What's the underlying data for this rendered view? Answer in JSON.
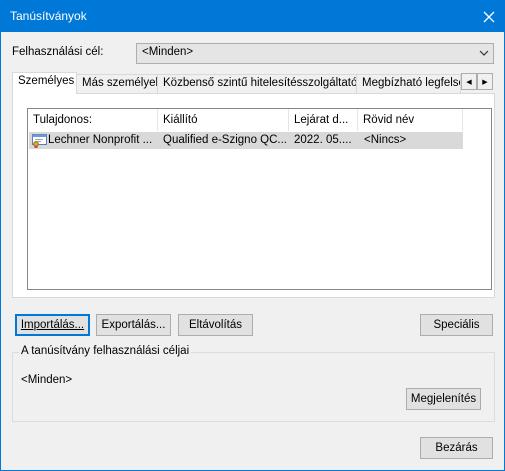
{
  "window": {
    "title": "Tanúsítványok",
    "close_glyph": "✕"
  },
  "purpose": {
    "label": "Felhasználási cél:",
    "value": "<Minden>"
  },
  "tabs": [
    {
      "label": "Személyes"
    },
    {
      "label": "Más személyek"
    },
    {
      "label": "Közbenső szintű hitelesítésszolgáltatók"
    },
    {
      "label": "Megbízható legfelső"
    }
  ],
  "tab_scroll": {
    "left": "◀",
    "right": "▶"
  },
  "list": {
    "columns": [
      "Tulajdonos:",
      "Kiállító",
      "Lejárat d...",
      "Rövid név"
    ],
    "rows": [
      {
        "owner": "Lechner Nonprofit ...",
        "issuer": "Qualified e-Szigno QC...",
        "expiry": "2022. 05....",
        "friendly": "<Nincs>"
      }
    ]
  },
  "buttons": {
    "import": "Importálás...",
    "export": "Exportálás...",
    "remove": "Eltávolítás",
    "advanced": "Speciális",
    "view": "Megjelenítés",
    "close": "Bezárás"
  },
  "purposes_group": {
    "title": "A tanúsítvány felhasználási céljai",
    "value": "<Minden>"
  },
  "icons": {
    "close": "close-icon",
    "dropdown": "chevron-down-icon",
    "cert": "certificate-icon"
  }
}
